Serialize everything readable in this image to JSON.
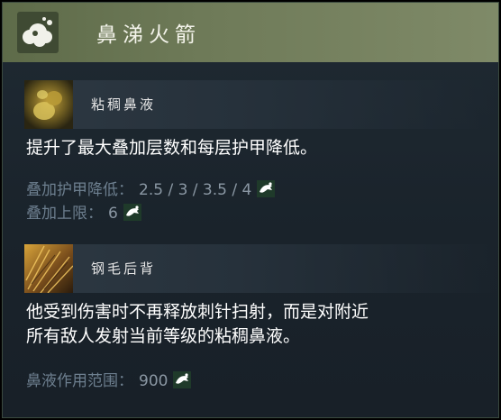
{
  "ability": {
    "title": "鼻涕火箭",
    "icon": "snot-cloud-icon"
  },
  "sections": [
    {
      "name": "粘稠鼻液",
      "thumb_icon": "sticky-snot-thumbnail",
      "description": "提升了最大叠加层数和每层护甲降低。",
      "stats": [
        {
          "label": "叠加护甲降低：",
          "value": "2.5 / 3 / 3.5 / 4"
        },
        {
          "label": "叠加上限：",
          "value": "6"
        }
      ]
    },
    {
      "name": "钢毛后背",
      "thumb_icon": "bristleback-thumbnail",
      "description_line1": "他受到伤害时不再释放刺针扫射，而是对附近",
      "description_line2": "所有敌人发射当前等级的粘稠鼻液。",
      "stats": [
        {
          "label": "鼻液作用范围：",
          "value": "900"
        }
      ]
    }
  ],
  "colors": {
    "header": "#6e7a58",
    "panel": "#1c252e",
    "stat_label": "#6d7f8f",
    "stat_value": "#8a97a3"
  },
  "stat_badge_icon": "aghanim-scepter-icon"
}
